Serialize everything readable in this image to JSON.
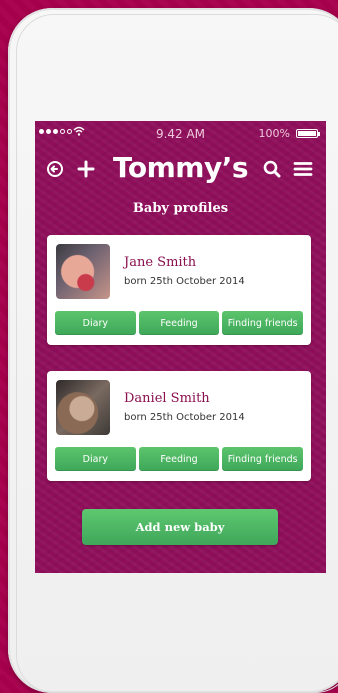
{
  "status": {
    "time": "9.42 AM",
    "battery": "100%"
  },
  "header": {
    "logo": "Tommy’s",
    "icons": [
      "back-arrow-icon",
      "plus-icon",
      "search-icon",
      "menu-icon"
    ]
  },
  "page_title": "Baby profiles",
  "babies": [
    {
      "name": "Jane Smith",
      "born": "born 25th October 2014",
      "buttons": [
        "Diary",
        "Feeding",
        "Finding friends"
      ]
    },
    {
      "name": "Daniel Smith",
      "born": "born 25th October 2014",
      "buttons": [
        "Diary",
        "Feeding",
        "Finding friends"
      ]
    }
  ],
  "add_button": "Add new baby",
  "colors": {
    "background": "#a8004d",
    "screen": "#8f0f5b",
    "accent_green": "#4cb863",
    "name_color": "#8a0f4f"
  }
}
